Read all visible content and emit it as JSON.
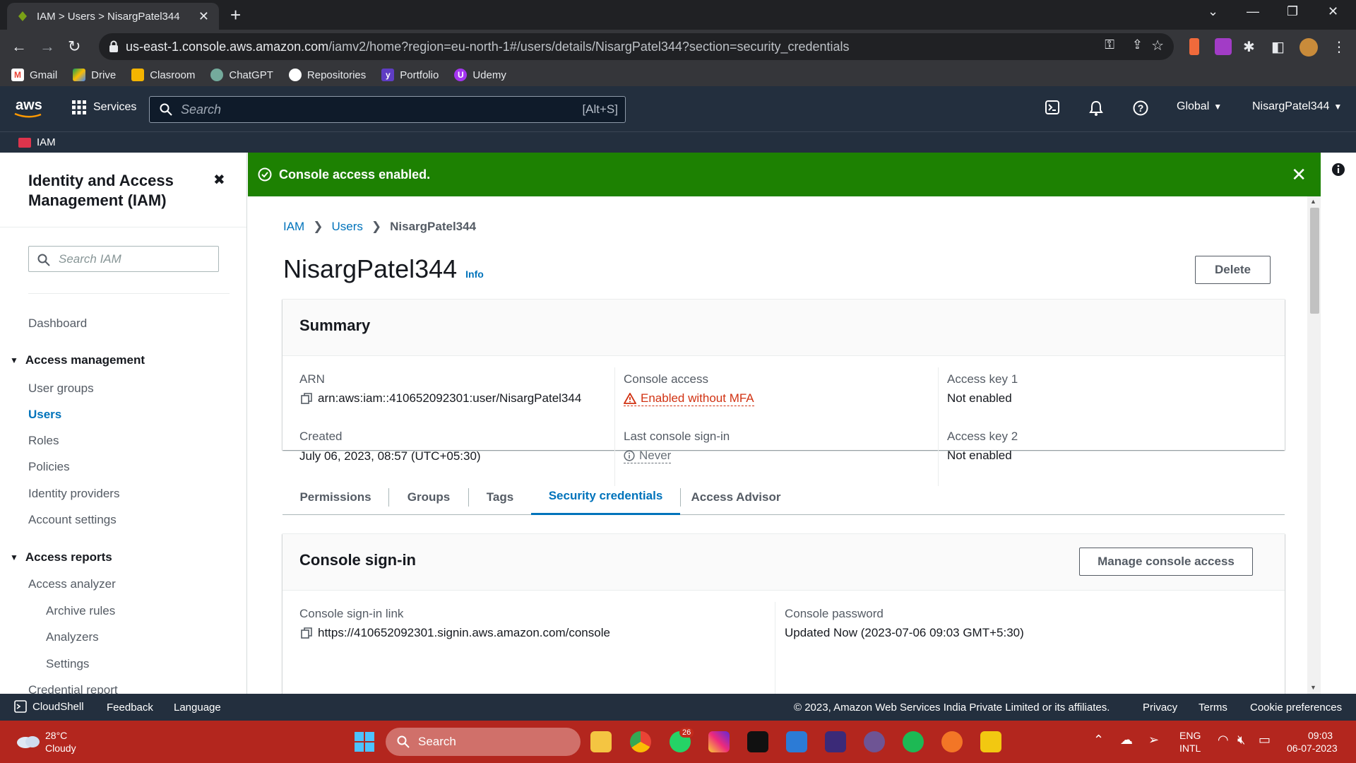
{
  "browser": {
    "tab_title": "IAM > Users > NisargPatel344",
    "url_host": "us-east-1.console.aws.amazon.com",
    "url_path": "/iamv2/home?region=eu-north-1#/users/details/NisargPatel344?section=security_credentials",
    "bookmarks": [
      "Gmail",
      "Drive",
      "Clasroom",
      "ChatGPT",
      "Repositories",
      "Portfolio",
      "Udemy"
    ]
  },
  "aws_nav": {
    "logo": "aws",
    "services": "Services",
    "search_placeholder": "Search",
    "search_shortcut": "[Alt+S]",
    "region": "Global",
    "account": "NisargPatel344",
    "service_name": "IAM"
  },
  "sidebar": {
    "title": "Identity and Access Management (IAM)",
    "search_placeholder": "Search IAM",
    "dashboard": "Dashboard",
    "access_management": "Access management",
    "am_items": [
      "User groups",
      "Users",
      "Roles",
      "Policies",
      "Identity providers",
      "Account settings"
    ],
    "access_reports": "Access reports",
    "access_analyzer": "Access analyzer",
    "aa_items": [
      "Archive rules",
      "Analyzers",
      "Settings"
    ],
    "credential_report": "Credential report"
  },
  "flash": {
    "message": "Console access enabled."
  },
  "breadcrumb": [
    "IAM",
    "Users",
    "NisargPatel344"
  ],
  "page": {
    "title": "NisargPatel344",
    "info": "Info",
    "delete": "Delete"
  },
  "summary": {
    "header": "Summary",
    "arn_label": "ARN",
    "arn_value": "arn:aws:iam::410652092301:user/NisargPatel344",
    "created_label": "Created",
    "created_value": "July 06, 2023, 08:57 (UTC+05:30)",
    "console_access_label": "Console access",
    "console_access_value": "Enabled without MFA",
    "last_signin_label": "Last console sign-in",
    "last_signin_value": "Never",
    "key1_label": "Access key 1",
    "key1_value": "Not enabled",
    "key2_label": "Access key 2",
    "key2_value": "Not enabled"
  },
  "tabs": [
    "Permissions",
    "Groups",
    "Tags",
    "Security credentials",
    "Access Advisor"
  ],
  "console_signin": {
    "header": "Console sign-in",
    "manage_button": "Manage console access",
    "link_label": "Console sign-in link",
    "link_value": "https://410652092301.signin.aws.amazon.com/console",
    "password_label": "Console password",
    "password_value": "Updated Now (2023-07-06 09:03 GMT+5:30)"
  },
  "footer": {
    "cloudshell": "CloudShell",
    "feedback": "Feedback",
    "language": "Language",
    "copyright": "© 2023, Amazon Web Services India Private Limited or its affiliates.",
    "privacy": "Privacy",
    "terms": "Terms",
    "cookies": "Cookie preferences"
  },
  "taskbar": {
    "weather_temp": "28°C",
    "weather_desc": "Cloudy",
    "search": "Search",
    "whatsapp_badge": "26",
    "lang1": "ENG",
    "lang2": "INTL",
    "time": "09:03",
    "date": "06-07-2023"
  }
}
